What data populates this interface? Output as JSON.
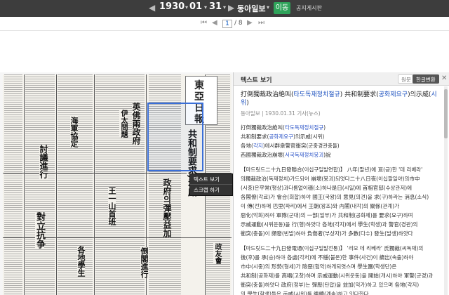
{
  "topbar": {
    "prev_arrow": "◀",
    "next_arrow": "▶",
    "year": "1930",
    "month": "01",
    "day": "31",
    "caret": "▾",
    "newspaper": "동아일보",
    "newspaper_caret": "▾",
    "move_button": "이동",
    "notice": "공지게시판"
  },
  "pagebar": {
    "first": "⏮",
    "prev": "◀",
    "current_page": "1",
    "total_pages": "/ 8",
    "next": "▶",
    "last": "⏭"
  },
  "context_menu": {
    "item1": "텍스트 보기",
    "item2": "스크랩 하기"
  },
  "newspaper_image": {
    "masthead": [
      "東",
      "亞",
      "日",
      "報"
    ],
    "headlines": [
      "共和制要求,示威",
      "英佛兩政府",
      "伊太問題",
      "討議進行",
      "政府의彈壓益加",
      "王一山首班",
      "對立抗争",
      "海軍協定",
      "政友會",
      "各地學生",
      "倒閣進行"
    ]
  },
  "panel": {
    "title": "텍스트 보기",
    "tab_original": "원문",
    "tab_korean": "한글변환",
    "close": "✕",
    "article_title_pre": "打倒獨裁政治絶叫(",
    "article_title_hl1": "타도독재정치절규",
    "article_title_mid": ") 共和制要求(",
    "article_title_hl2": "공화제요구",
    "article_title_post": ")의示威(",
    "article_title_hl3": "시위",
    "article_title_end": ")",
    "meta": "동아일보 | 1930.01.31  기사(뉴스)",
    "summary": [
      {
        "pre": "打倒獨裁政治絶叫(",
        "hl": "타도독재정치절규",
        "post": ")"
      },
      {
        "pre": "共和制要求(",
        "hl": "공화제요구",
        "post": ")의示威(시위)"
      },
      {
        "pre": "各地(",
        "hl": "각지",
        "post": ")에서群衆警官衝突(군중경관충돌)"
      },
      {
        "pre": "西國獨裁政治崩壞(",
        "hl": "서국독재정치붕괴",
        "post": ")說"
      }
    ],
    "para1": [
      "【마드릿드二十九日發聯合(이십구일발연합)】 八年(팔년)에 亘(긍)한 '데 리베라'",
      "의獨裁政治(독재정치)가드되어 崩壞(붕괴)되엇다二十八日夜(이십팔일야)의市中",
      "(시중)은平常(평상)과다름없이穩(소)하나是日(시일)에 首相官邸(수상관저)에",
      "各閣僚(각료)가 會合(회합)하야 國王(국왕)의 意見(의견)을 求(구)하라는 消息(소식)",
      "이 傳(전)하매 巴里(파리)에서 王朝(왕조)와 內閣(내각)의 關係(관계)가 ",
      "惡化(악화)하야 軍隊(군대)의 一部(일부)가 共和制(공화제)를 要求(요구)하며",
      "示威運動(시위운동)을 行(행)하얏다 各地(각지)에서 學生(학생)과 警官(경관)의",
      "衝突(충돌)이 頻發(빈발)하야 負傷者(부상자)가 多數(다수) 發生(발생)하얏다"
    ],
    "para2": [
      "【마드릿드二十九日發電通(이십구일발전통)】 '리모 데 리베라' 氏獨裁(씨독재)의",
      "後(후)를 承(승)하야 各處(각처)에 不穩(불온)한 事件(사건)이 續出(속출)하야",
      "市中(시중)의 形勢(형세)가 險惡(험악)하게되엿스며 學生團(학생단)은",
      "共和制(공화제)를 高唱(고창)하며 示威運動(시위운동)을 開始(개시)하야 軍警(군경)과",
      "衝突(충돌)하얏다 政府(정부)는 彈壓(탄압)을 益加(익가)하고 있으며 各地(각지)",
      "의 學生(학생)들은 示威(시위)를 繼續(계속)하고 잇다한다"
    ]
  }
}
